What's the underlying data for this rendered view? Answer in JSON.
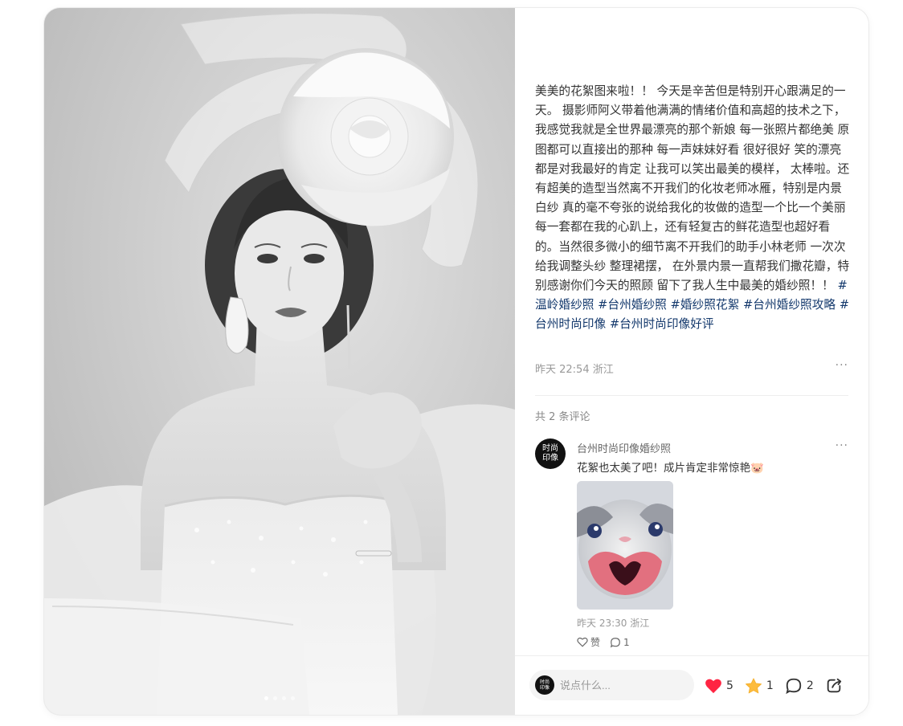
{
  "photo": {
    "image_count": 4,
    "current_index": 1
  },
  "post": {
    "text": "美美的花絮图来啦！！ 今天是辛苦但是特别开心跟满足的一天。 摄影师阿义带着他满满的情绪价值和高超的技术之下， 我感觉我就是全世界最漂亮的那个新娘 每一张照片都绝美 原图都可以直接出的那种 每一声妹妹好看 很好很好 笑的漂亮 都是对我最好的肯定 让我可以笑出最美的模样， 太棒啦。还有超美的造型当然离不开我们的化妆老师冰雁，特别是内景白纱 真的毫不夸张的说给我化的妆做的造型一个比一个美丽 每一套都在我的心趴上，还有轻复古的鲜花造型也超好看的。当然很多微小的细节离不开我们的助手小林老师 一次次给我调整头纱 整理裙摆， 在外景内景一直帮我们撒花瓣，特别感谢你们今天的照顾 留下了我人生中最美的婚纱照！！",
    "tags": [
      "#温岭婚纱照",
      "#台州婚纱照",
      "#婚纱照花絮",
      "#台州婚纱照攻略",
      "#台州时尚印像",
      "#台州时尚印像好评"
    ],
    "meta": "昨天 22:54 浙江",
    "more_icon": "more-dots-icon"
  },
  "comments": {
    "count_label": "共 2 条评论",
    "items": [
      {
        "avatar_text": "时尚印像",
        "author": "台州时尚印像婚纱照",
        "text": "花絮也太美了吧！成片肯定非常惊艳🐷",
        "time": "昨天 23:30 浙江",
        "like_label": "赞",
        "reply_count": "1"
      }
    ]
  },
  "bottom_bar": {
    "avatar_text": "时尚印像",
    "input_placeholder": "说点什么...",
    "likes": "5",
    "collects": "1",
    "comments": "2",
    "colors": {
      "like": "#ff2442",
      "collect": "#fdbc3d"
    }
  }
}
